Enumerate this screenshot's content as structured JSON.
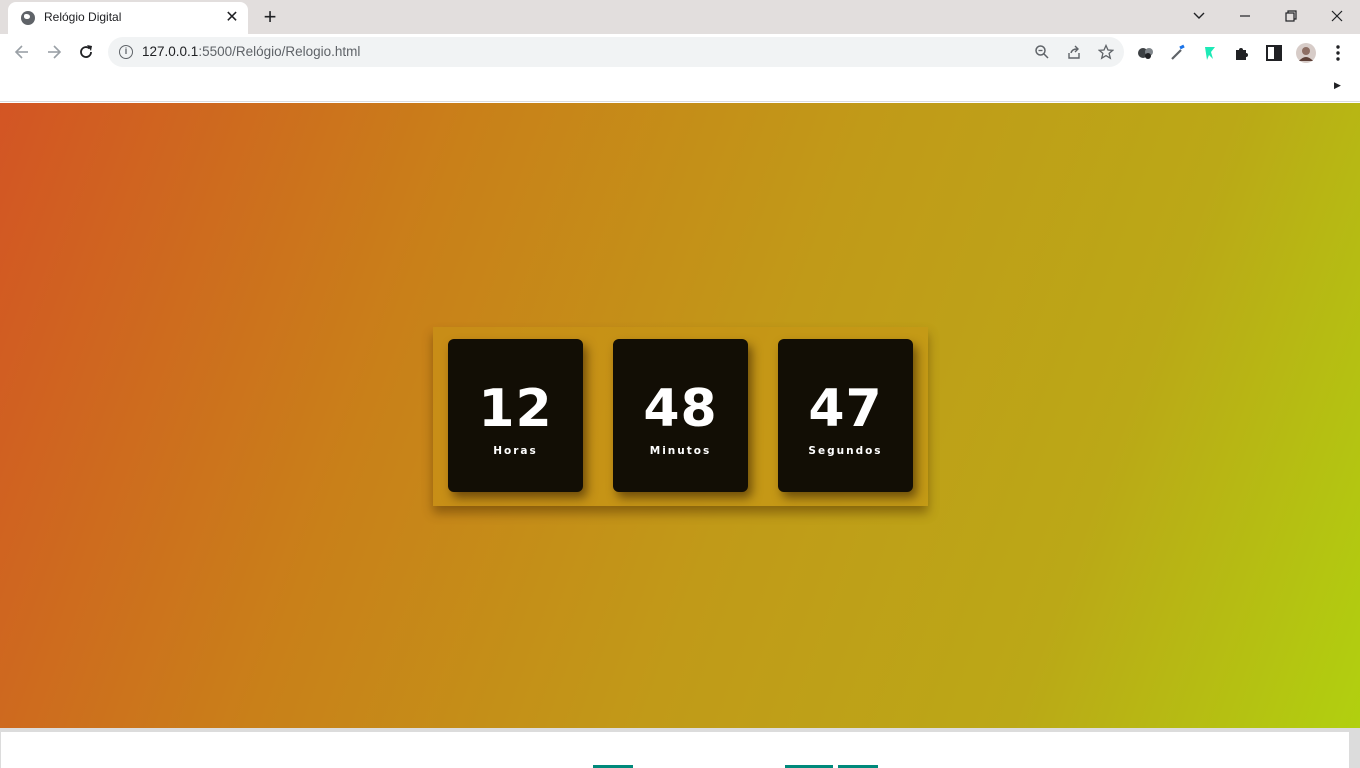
{
  "browser": {
    "tab": {
      "title": "Relógio Digital",
      "favicon": "globe-icon",
      "close_glyph": "✕"
    },
    "new_tab_glyph": "+",
    "url": {
      "host": "127.0.0.1",
      "rest": ":5500/Relógio/Relogio.html"
    },
    "omnibox_icons": [
      "zoom-icon",
      "share-icon",
      "bookmark-star-icon"
    ],
    "extensions": [
      "extension-people-icon",
      "extension-eyedropper-icon",
      "extension-figma-icon",
      "extensions-puzzle-icon",
      "side-panel-icon",
      "profile-avatar",
      "menu-kebab-icon"
    ]
  },
  "page": {
    "background_colors": [
      "#d35524",
      "#c98019",
      "#c19a18",
      "#bba817",
      "#b1d00f"
    ],
    "card_color": "#120e05",
    "clock": {
      "hours": {
        "value": "12",
        "label": "Horas"
      },
      "minutes": {
        "value": "48",
        "label": "Minutos"
      },
      "seconds": {
        "value": "47",
        "label": "Segundos"
      }
    }
  }
}
